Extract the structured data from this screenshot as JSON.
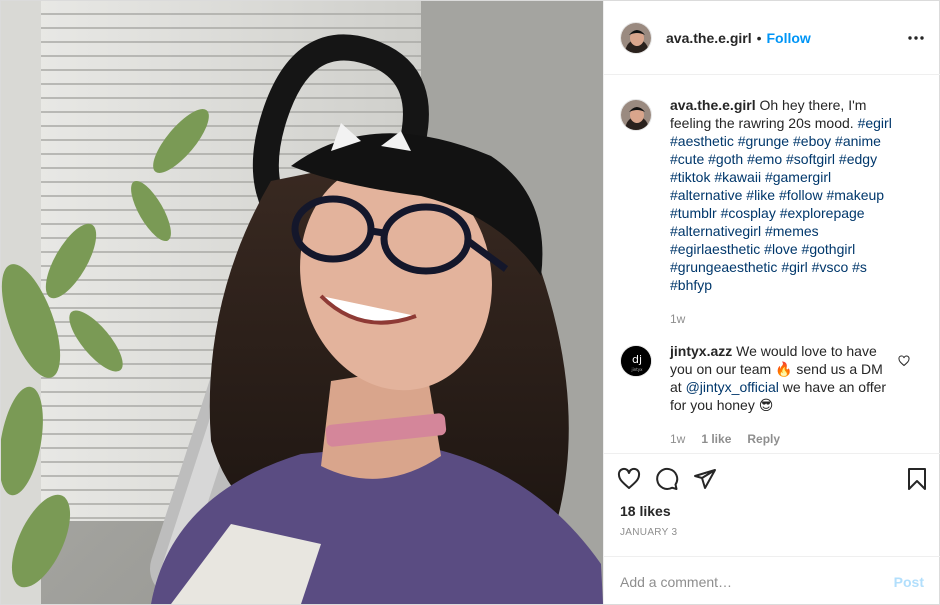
{
  "post": {
    "author": "ava.the.e.girl",
    "follow_label": "Follow",
    "separator": "•",
    "more_icon": "more-horizontal-icon"
  },
  "caption": {
    "username": "ava.the.e.girl",
    "text": "Oh hey there, I'm feeling the rawring 20s mood.",
    "hashtags": [
      "#egirl",
      "#aesthetic",
      "#grunge",
      "#eboy",
      "#anime",
      "#cute",
      "#goth",
      "#emo",
      "#softgirl",
      "#edgy",
      "#tiktok",
      "#kawaii",
      "#gamergirl",
      "#alternative",
      "#like",
      "#follow",
      "#makeup",
      "#tumblr",
      "#cosplay",
      "#explorepage",
      "#alternativegirl",
      "#memes",
      "#egirlaesthetic",
      "#love",
      "#gothgirl",
      "#grungeaesthetic",
      "#girl",
      "#vsco",
      "#s",
      "#bhfyp"
    ],
    "time": "1w"
  },
  "reply": {
    "username": "jintyx.azz",
    "text_before": "We would love to have you on our team",
    "emoji_fire": "🔥",
    "text_middle": "send us a DM at",
    "mention": "@jintyx_official",
    "text_after": "we have an offer for you honey",
    "emoji_end": "😎",
    "time": "1w",
    "likes": "1 like",
    "reply_label": "Reply",
    "avatar_text": "jintyx"
  },
  "actions": {
    "like_icon": "heart-icon",
    "comment_icon": "comment-icon",
    "share_icon": "share-icon",
    "save_icon": "bookmark-icon"
  },
  "stats": {
    "likes": "18 likes",
    "date": "JANUARY 3"
  },
  "add_comment": {
    "placeholder": "Add a comment…",
    "post_label": "Post"
  },
  "colors": {
    "accent": "#0095f6",
    "hashtag": "#00376b",
    "muted": "#8e8e8e",
    "post_disabled": "#b2dffc"
  }
}
